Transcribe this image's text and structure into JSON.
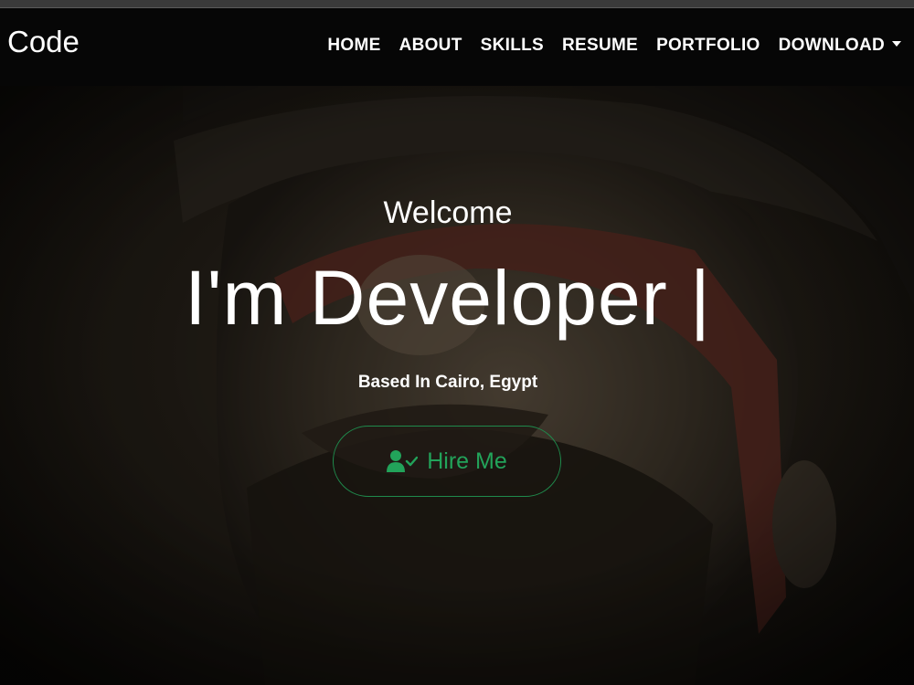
{
  "brand": {
    "name": "Code"
  },
  "nav": {
    "items": [
      {
        "label": "HOME"
      },
      {
        "label": "ABOUT"
      },
      {
        "label": "SKILLS"
      },
      {
        "label": "RESUME"
      },
      {
        "label": "PORTFOLIO"
      },
      {
        "label": "DOWNLOAD"
      }
    ]
  },
  "hero": {
    "welcome": "Welcome",
    "headline": "I'm Developer |",
    "location": "Based In Cairo, Egypt",
    "button": {
      "label": "Hire Me",
      "icon": "user-check-icon"
    }
  },
  "colors": {
    "accent": "#22a35a",
    "navbar": "#060606",
    "text": "#ffffff"
  }
}
